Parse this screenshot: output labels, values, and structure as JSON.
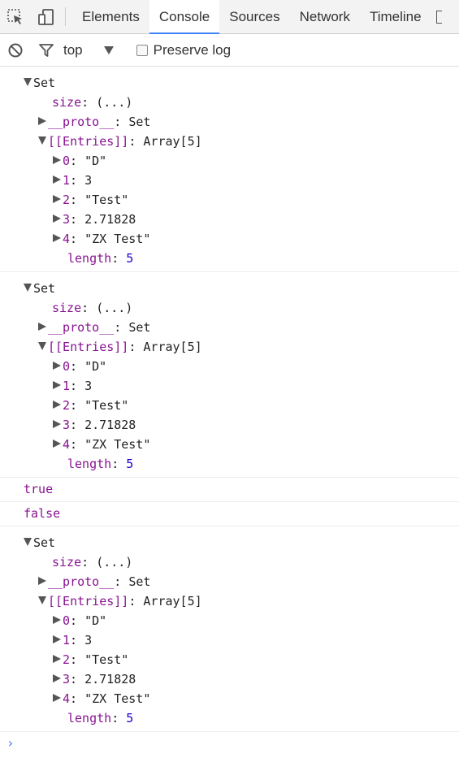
{
  "tabs": [
    {
      "label": "Elements",
      "active": false
    },
    {
      "label": "Console",
      "active": true
    },
    {
      "label": "Sources",
      "active": false
    },
    {
      "label": "Network",
      "active": false
    },
    {
      "label": "Timeline",
      "active": false
    }
  ],
  "toolbar": {
    "context": "top",
    "preserve_log_label": "Preserve log",
    "preserve_log_checked": false
  },
  "console": {
    "set1": {
      "title": "Set",
      "size_key": "size",
      "size_val": "(...)",
      "proto_key": "__proto__",
      "proto_val": "Set",
      "entries_key": "[[Entries]]",
      "entries_val": "Array[5]",
      "entries": [
        {
          "k": "0",
          "v": "\"D\"",
          "type": "str"
        },
        {
          "k": "1",
          "v": "3",
          "type": "str"
        },
        {
          "k": "2",
          "v": "\"Test\"",
          "type": "str"
        },
        {
          "k": "3",
          "v": "2.71828",
          "type": "str"
        },
        {
          "k": "4",
          "v": "\"ZX Test\"",
          "type": "str"
        }
      ],
      "length_key": "length",
      "length_val": "5"
    },
    "set2": {
      "title": "Set",
      "size_key": "size",
      "size_val": "(...)",
      "proto_key": "__proto__",
      "proto_val": "Set",
      "entries_key": "[[Entries]]",
      "entries_val": "Array[5]",
      "entries": [
        {
          "k": "0",
          "v": "\"D\"",
          "type": "str"
        },
        {
          "k": "1",
          "v": "3",
          "type": "str"
        },
        {
          "k": "2",
          "v": "\"Test\"",
          "type": "str"
        },
        {
          "k": "3",
          "v": "2.71828",
          "type": "str"
        },
        {
          "k": "4",
          "v": "\"ZX Test\"",
          "type": "str"
        }
      ],
      "length_key": "length",
      "length_val": "5"
    },
    "bool1": "true",
    "bool2": "false",
    "set3": {
      "title": "Set",
      "size_key": "size",
      "size_val": "(...)",
      "proto_key": "__proto__",
      "proto_val": "Set",
      "entries_key": "[[Entries]]",
      "entries_val": "Array[5]",
      "entries": [
        {
          "k": "0",
          "v": "\"D\"",
          "type": "str"
        },
        {
          "k": "1",
          "v": "3",
          "type": "str"
        },
        {
          "k": "2",
          "v": "\"Test\"",
          "type": "str"
        },
        {
          "k": "3",
          "v": "2.71828",
          "type": "str"
        },
        {
          "k": "4",
          "v": "\"ZX Test\"",
          "type": "str"
        }
      ],
      "length_key": "length",
      "length_val": "5"
    },
    "prompt": "›"
  },
  "colors": {
    "accent": "#3e82f7",
    "key": "#881391",
    "number": "#1c00cf"
  }
}
